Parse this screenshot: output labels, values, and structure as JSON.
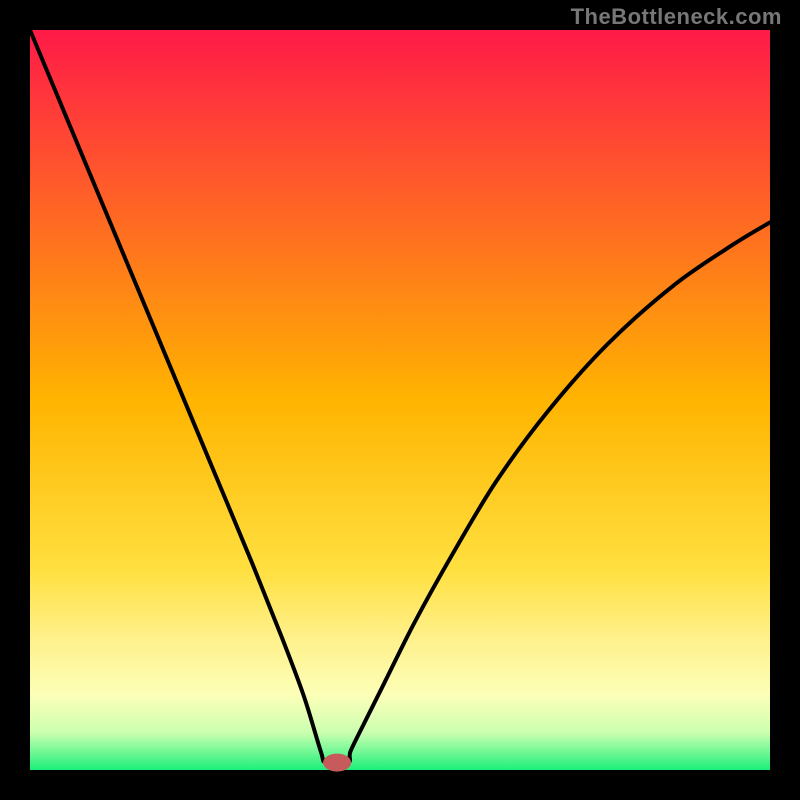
{
  "watermark": "TheBottleneck.com",
  "chart_data": {
    "type": "line",
    "title": "",
    "xlabel": "",
    "ylabel": "",
    "xlim": [
      0,
      100
    ],
    "ylim": [
      0,
      100
    ],
    "grid": false,
    "legend": false,
    "annotations": [],
    "background_gradient": {
      "type": "vertical",
      "stops": [
        {
          "offset": 0.0,
          "color": "#ff1a48"
        },
        {
          "offset": 0.5,
          "color": "#ffb400"
        },
        {
          "offset": 0.73,
          "color": "#ffe040"
        },
        {
          "offset": 0.82,
          "color": "#fff08a"
        },
        {
          "offset": 0.9,
          "color": "#fcffb8"
        },
        {
          "offset": 0.95,
          "color": "#caffb0"
        },
        {
          "offset": 1.0,
          "color": "#1cf07a"
        }
      ]
    },
    "marker": {
      "x": 41.5,
      "y": 1.0,
      "color": "#c75a5a"
    },
    "series": [
      {
        "name": "curve",
        "x": [
          0.0,
          5.0,
          10.0,
          15.0,
          20.0,
          25.0,
          30.0,
          34.0,
          37.0,
          39.3,
          40.0,
          43.0,
          43.3,
          45.0,
          48.0,
          52.0,
          57.0,
          63.0,
          70.0,
          78.0,
          87.0,
          95.0,
          100.0
        ],
        "y": [
          100.0,
          88.0,
          76.0,
          64.0,
          52.0,
          40.0,
          28.0,
          18.0,
          10.0,
          2.5,
          1.0,
          1.0,
          2.5,
          6.0,
          12.0,
          20.0,
          29.0,
          39.0,
          48.5,
          57.5,
          65.5,
          71.0,
          74.0
        ]
      }
    ]
  }
}
